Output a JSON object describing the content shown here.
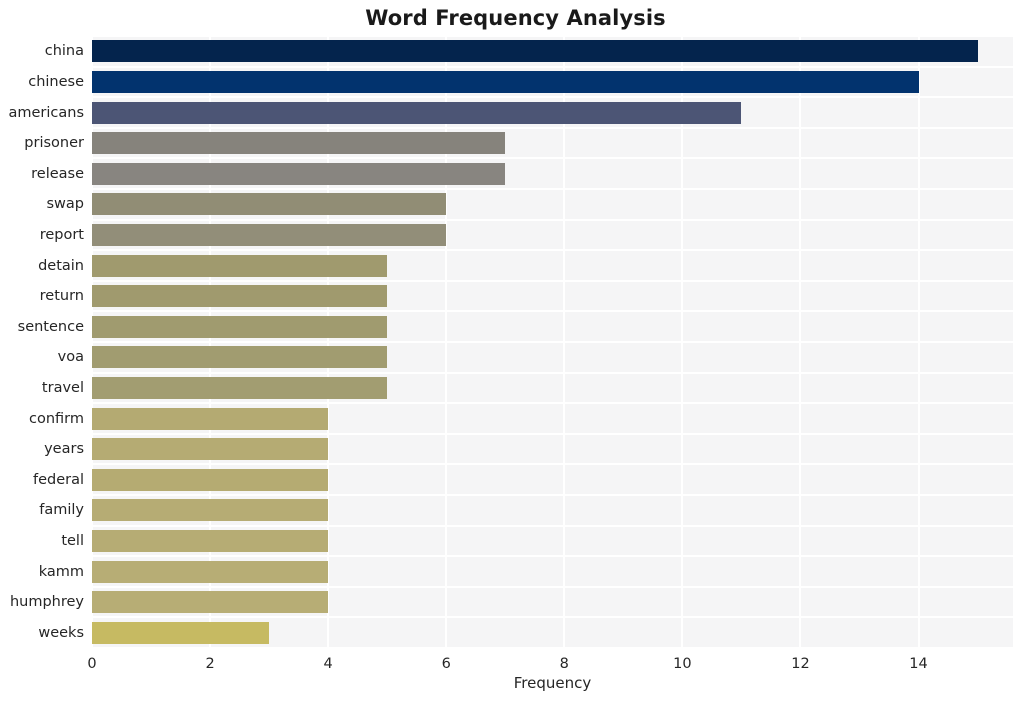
{
  "chart_data": {
    "type": "bar",
    "orientation": "horizontal",
    "title": "Word Frequency Analysis",
    "xlabel": "Frequency",
    "ylabel": "",
    "xlim": [
      0,
      15.6
    ],
    "xticks": [
      0,
      2,
      4,
      6,
      8,
      10,
      12,
      14
    ],
    "xtick_labels": [
      "0",
      "2",
      "4",
      "6",
      "8",
      "10",
      "12",
      "14"
    ],
    "grid": true,
    "grid_color": "#ffffff",
    "plot_background": "#f5f5f6",
    "figure_background": "#ffffff",
    "legend": null,
    "categories": [
      "china",
      "chinese",
      "americans",
      "prisoner",
      "release",
      "swap",
      "report",
      "detain",
      "return",
      "sentence",
      "voa",
      "travel",
      "confirm",
      "years",
      "federal",
      "family",
      "tell",
      "kamm",
      "humphrey",
      "weeks"
    ],
    "values": [
      15,
      14,
      11,
      7,
      7,
      6,
      6,
      5,
      5,
      5,
      5,
      5,
      4,
      4,
      4,
      4,
      4,
      4,
      4,
      3
    ],
    "bar_colors": [
      "#04244d",
      "#02336e",
      "#4c5575",
      "#86837c",
      "#888580",
      "#918d75",
      "#928e79",
      "#a09a6e",
      "#a09a6e",
      "#a09b6f",
      "#a19c70",
      "#a29d71",
      "#b4aa72",
      "#b5ab73",
      "#b5ab72",
      "#b6ac74",
      "#b6ac74",
      "#b7ad75",
      "#b7ad75",
      "#c6ba62"
    ]
  }
}
